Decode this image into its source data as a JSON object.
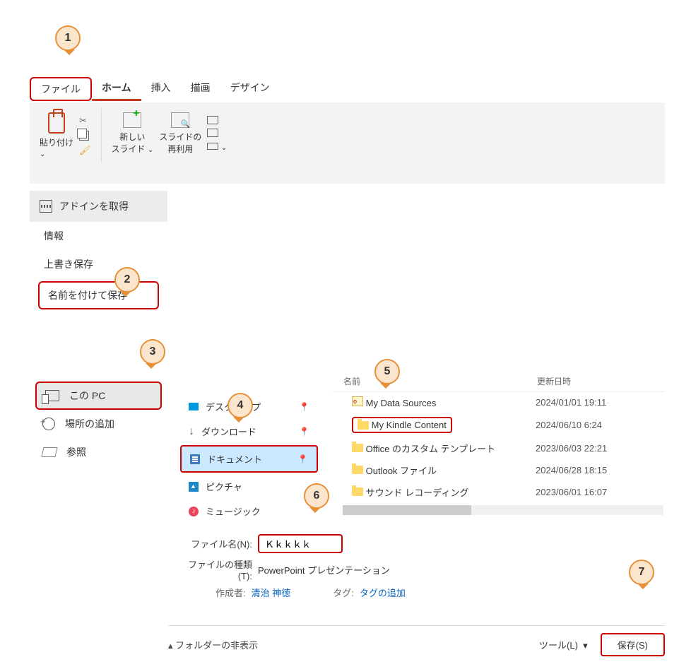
{
  "tabs": {
    "file": "ファイル",
    "home": "ホーム",
    "insert": "挿入",
    "draw": "描画",
    "design": "デザイン"
  },
  "ribbon": {
    "paste": "貼り付け",
    "new_slide": "新しい\nスライド",
    "reuse_slide": "スライドの\n再利用"
  },
  "backmenu": {
    "addin": "アドインを取得",
    "info": "情報",
    "save": "上書き保存",
    "saveas": "名前を付けて保存"
  },
  "locations": {
    "this_pc": "この PC",
    "add_location": "場所の追加",
    "browse": "参照"
  },
  "nav": {
    "desktop": "デスクトップ",
    "downloads": "ダウンロード",
    "documents": "ドキュメント",
    "pictures": "ピクチャ",
    "music": "ミュージック"
  },
  "listhead": {
    "name": "名前",
    "date": "更新日時"
  },
  "files": [
    {
      "name": "My Data Sources",
      "date": "2024/01/01 19:11",
      "type": "ds"
    },
    {
      "name": "My Kindle Content",
      "date": "2024/06/10 6:24",
      "type": "folder",
      "boxed": true
    },
    {
      "name": "Office のカスタム テンプレート",
      "date": "2023/06/03 22:21",
      "type": "folder"
    },
    {
      "name": "Outlook ファイル",
      "date": "2024/06/28 18:15",
      "type": "folder"
    },
    {
      "name": "サウンド レコーディング",
      "date": "2023/06/01 16:07",
      "type": "folder"
    }
  ],
  "form": {
    "filename_label": "ファイル名(N):",
    "filename_value": "Ｋｋｋｋｋ",
    "filetype_label": "ファイルの種類(T):",
    "filetype_value": "PowerPoint プレゼンテーション",
    "author_label": "作成者:",
    "author_value": "清治 神徳",
    "tag_label": "タグ:",
    "tag_value": "タグの追加"
  },
  "footer": {
    "hide_folders": "フォルダーの非表示",
    "tools": "ツール(L)",
    "save": "保存(S)"
  },
  "callouts": {
    "c1": "1",
    "c2": "2",
    "c3": "3",
    "c4": "4",
    "c5": "5",
    "c6": "6",
    "c7": "7"
  }
}
